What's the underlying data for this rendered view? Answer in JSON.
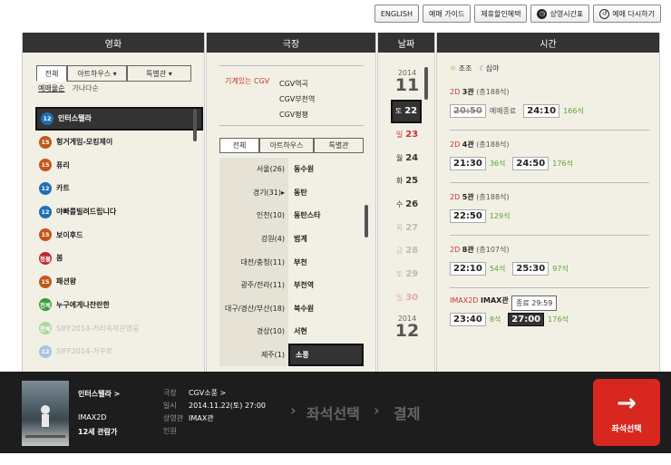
{
  "top_buttons": {
    "english": "ENGLISH",
    "guide": "예매 가이드",
    "discount": "제휴할인혜택",
    "schedule": "상영시간표",
    "reset": "예매 다시하기"
  },
  "movie": {
    "header": "영화",
    "tabs": [
      "전체",
      "아트하우스 ▾",
      "특별관 ▾"
    ],
    "sort": [
      "예매율순",
      "가나다순"
    ],
    "items": [
      {
        "age": "12",
        "color": "#1f6fb5",
        "title": "인터스텔라",
        "state": "selected"
      },
      {
        "age": "15",
        "color": "#c2561b",
        "title": "헝거게임-모킹제이",
        "state": "normal"
      },
      {
        "age": "15",
        "color": "#c2561b",
        "title": "퓨리",
        "state": "normal"
      },
      {
        "age": "12",
        "color": "#1f6fb5",
        "title": "카트",
        "state": "normal"
      },
      {
        "age": "12",
        "color": "#1f6fb5",
        "title": "야빠를빌려드립니다",
        "state": "normal"
      },
      {
        "age": "15",
        "color": "#c2561b",
        "title": "보이후드",
        "state": "normal"
      },
      {
        "age": "청불",
        "color": "#c0252a",
        "title": "봄",
        "state": "normal"
      },
      {
        "age": "15",
        "color": "#c2561b",
        "title": "패션왕",
        "state": "normal"
      },
      {
        "age": "전체",
        "color": "#3a9a3a",
        "title": "누구에게나찬란한",
        "state": "normal"
      },
      {
        "age": "전체",
        "color": "#a9d69a",
        "title": "SIFF2014-거리속작은영웅",
        "state": "dim"
      },
      {
        "age": "12",
        "color": "#a8c4e0",
        "title": "SIFF2014-거꾸로",
        "state": "dim"
      }
    ]
  },
  "theater": {
    "header": "극장",
    "favorite_label": "기계있는 CGV",
    "favorites": [
      "CGV역곡",
      "CGV부천역",
      "CGV평평"
    ],
    "tabs": [
      "전체",
      "아트하우스",
      "특별관"
    ],
    "rows": [
      {
        "region": "서울(26)",
        "theater": "동수원",
        "selected": false
      },
      {
        "region": "경기(31)▸",
        "theater": "동탄",
        "selected": false
      },
      {
        "region": "인천(10)",
        "theater": "동탄스타",
        "selected": false
      },
      {
        "region": "강원(4)",
        "theater": "범계",
        "selected": false
      },
      {
        "region": "대전/충청(11)",
        "theater": "부천",
        "selected": false
      },
      {
        "region": "광주/전라(11)",
        "theater": "부천역",
        "selected": false
      },
      {
        "region": "대구/경산/부산(18)",
        "theater": "북수원",
        "selected": false
      },
      {
        "region": "경상(10)",
        "theater": "서현",
        "selected": false
      },
      {
        "region": "제주(1)",
        "theater": "소풍",
        "selected": true
      }
    ]
  },
  "date": {
    "header": "날짜",
    "year1": "2014",
    "month1": "11",
    "days": [
      {
        "dow": "토",
        "day": "22",
        "state": "selected"
      },
      {
        "dow": "일",
        "day": "23",
        "state": "sunday"
      },
      {
        "dow": "월",
        "day": "24",
        "state": "normal"
      },
      {
        "dow": "화",
        "day": "25",
        "state": "normal"
      },
      {
        "dow": "수",
        "day": "26",
        "state": "normal"
      },
      {
        "dow": "목",
        "day": "27",
        "state": "disabled"
      },
      {
        "dow": "금",
        "day": "28",
        "state": "disabled"
      },
      {
        "dow": "토",
        "day": "29",
        "state": "disabled"
      },
      {
        "dow": "일",
        "day": "30",
        "state": "disabled-sunday"
      }
    ],
    "year2": "2014",
    "month2": "12"
  },
  "time": {
    "header": "시간",
    "legend_morning": "조조",
    "legend_night": "심야",
    "halls": [
      {
        "fmt": "2D",
        "name": "3관",
        "total": "(총188석)",
        "slots": [
          {
            "time": "20:50",
            "seats": "예매종료",
            "state": "old"
          },
          {
            "time": "24:10",
            "seats": "166석",
            "state": "normal"
          }
        ]
      },
      {
        "fmt": "2D",
        "name": "4관",
        "total": "(총188석)",
        "slots": [
          {
            "time": "21:30",
            "seats": "36석",
            "state": "normal"
          },
          {
            "time": "24:50",
            "seats": "176석",
            "state": "normal"
          }
        ]
      },
      {
        "fmt": "2D",
        "name": "5관",
        "total": "(총188석)",
        "slots": [
          {
            "time": "22:50",
            "seats": "129석",
            "state": "normal"
          }
        ]
      },
      {
        "fmt": "2D",
        "name": "8관",
        "total": "(총107석)",
        "slots": [
          {
            "time": "22:10",
            "seats": "54석",
            "state": "normal"
          },
          {
            "time": "25:30",
            "seats": "97석",
            "state": "normal"
          }
        ]
      },
      {
        "fmt": "IMAX2D",
        "name": "IMAX관",
        "total": "",
        "slots": [
          {
            "time": "23:40",
            "seats": "8석",
            "state": "normal"
          },
          {
            "time": "27:00",
            "seats": "176석",
            "state": "selected"
          }
        ]
      }
    ],
    "tooltip": "종료 29:59"
  },
  "bottom": {
    "movie_title": "인터스텔라 >",
    "format": "IMAX2D",
    "rating": "12세 관람가",
    "theater_label": "극장",
    "theater_value": "CGV소풍 >",
    "datetime_label": "일시",
    "datetime_value": "2014.11.22(토) 27:00",
    "hall_label": "상영관",
    "hall_value": "IMAX관",
    "people_label": "인원",
    "step1": "좌석선택",
    "step2": "결제",
    "button": "좌석선택"
  }
}
